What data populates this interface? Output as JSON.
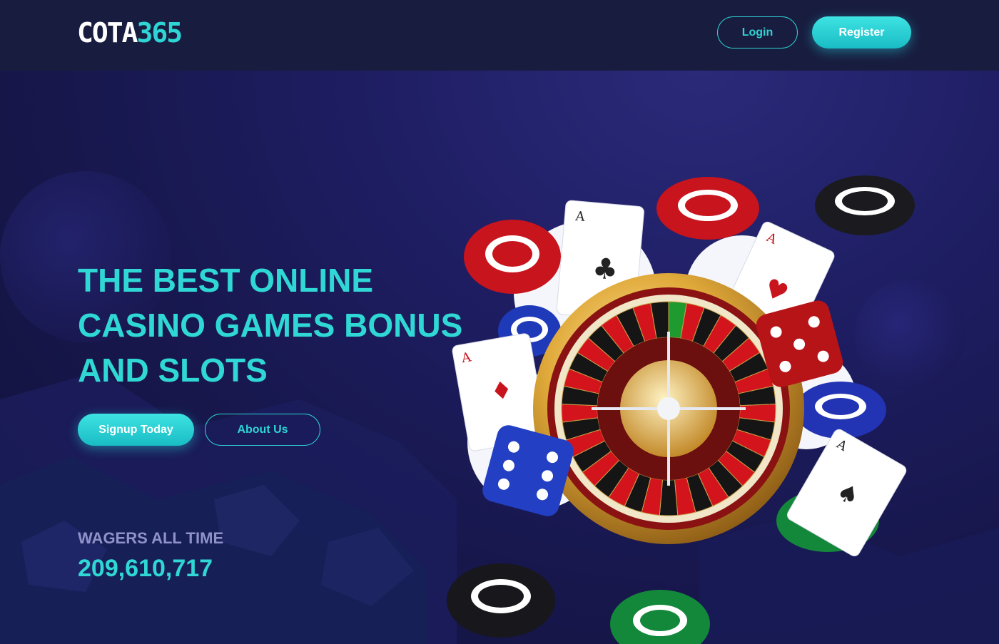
{
  "header": {
    "logo_part1": "COTA",
    "logo_part2": "365",
    "login_label": "Login",
    "register_label": "Register"
  },
  "hero": {
    "headline": "THE BEST ONLINE CASINO GAMES BONUS AND SLOTS",
    "signup_label": "Signup Today",
    "about_label": "About Us"
  },
  "stats": {
    "wagers_label": "WAGERS ALL TIME",
    "wagers_value": "209,610,717"
  },
  "colors": {
    "accent": "#2fd4d4",
    "background": "#1e1d62",
    "header": "#181d3f"
  }
}
